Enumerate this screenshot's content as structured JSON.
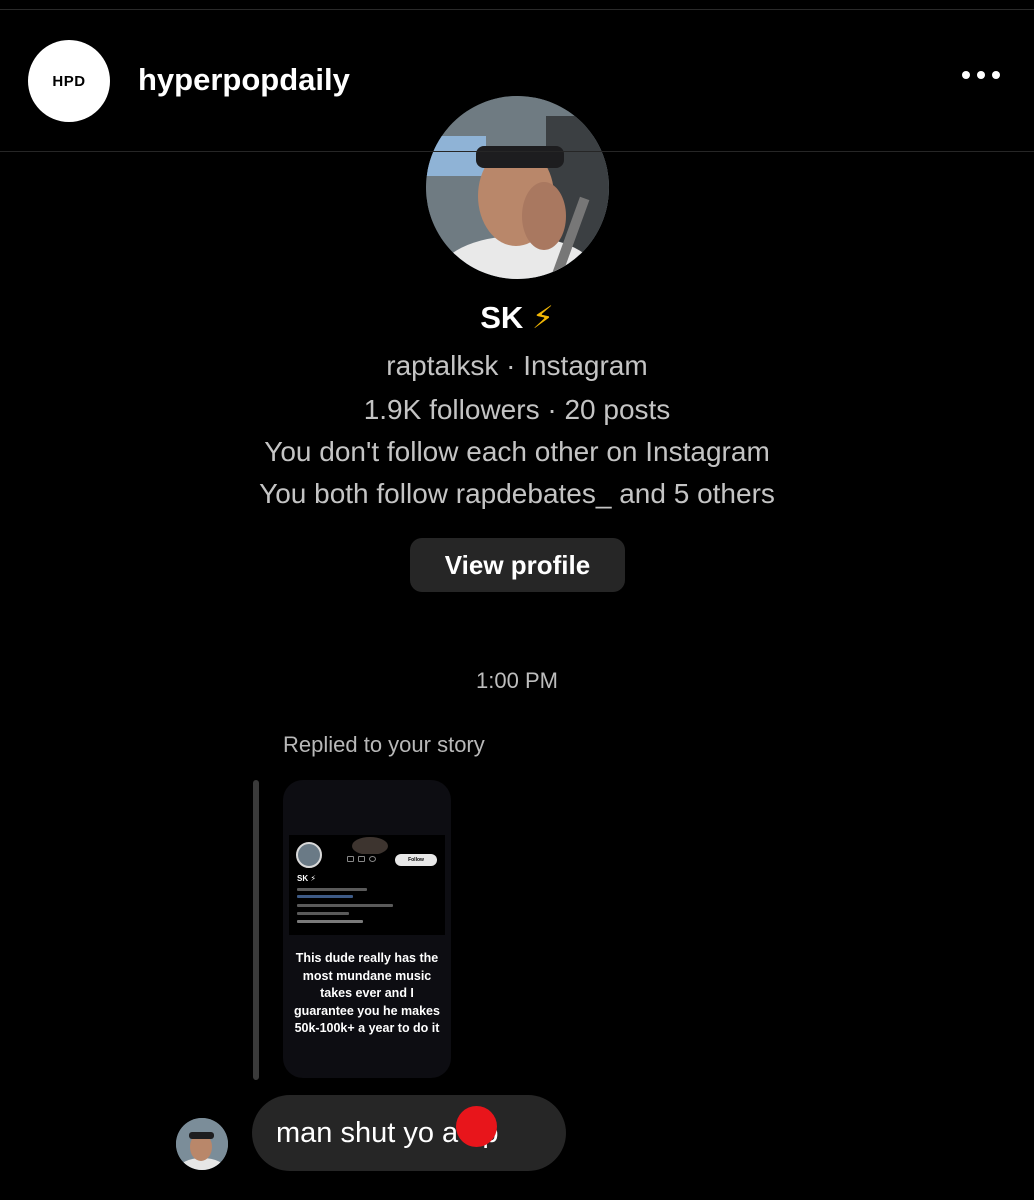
{
  "header": {
    "logo_text": "HPD",
    "account_name": "hyperpopdaily",
    "more_icon": "more-horizontal-icon"
  },
  "profile": {
    "name": "SK",
    "name_emoji": "⚡",
    "handle_line": "raptalksk · Instagram",
    "stats_line": "1.9K followers · 20 posts",
    "follow_status": "You don't follow each other on Instagram",
    "mutual_line": "You both follow rapdebates_ and 5 others",
    "view_profile_label": "View profile"
  },
  "thread": {
    "timestamp": "1:00 PM",
    "reply_note": "Replied to your story",
    "story": {
      "follow_label": "Follow",
      "name": "SK ⚡",
      "caption": "This dude really has the most mundane music takes ever and I guarantee you he makes 50k-100k+ a year to do it"
    },
    "message_text": "man shut yo a   up"
  },
  "colors": {
    "background": "#000000",
    "bubble": "#262626",
    "button": "#262626",
    "secondary_text": "#c4c4c4",
    "censor_red": "#e8151b",
    "bolt": "#f2b705"
  }
}
